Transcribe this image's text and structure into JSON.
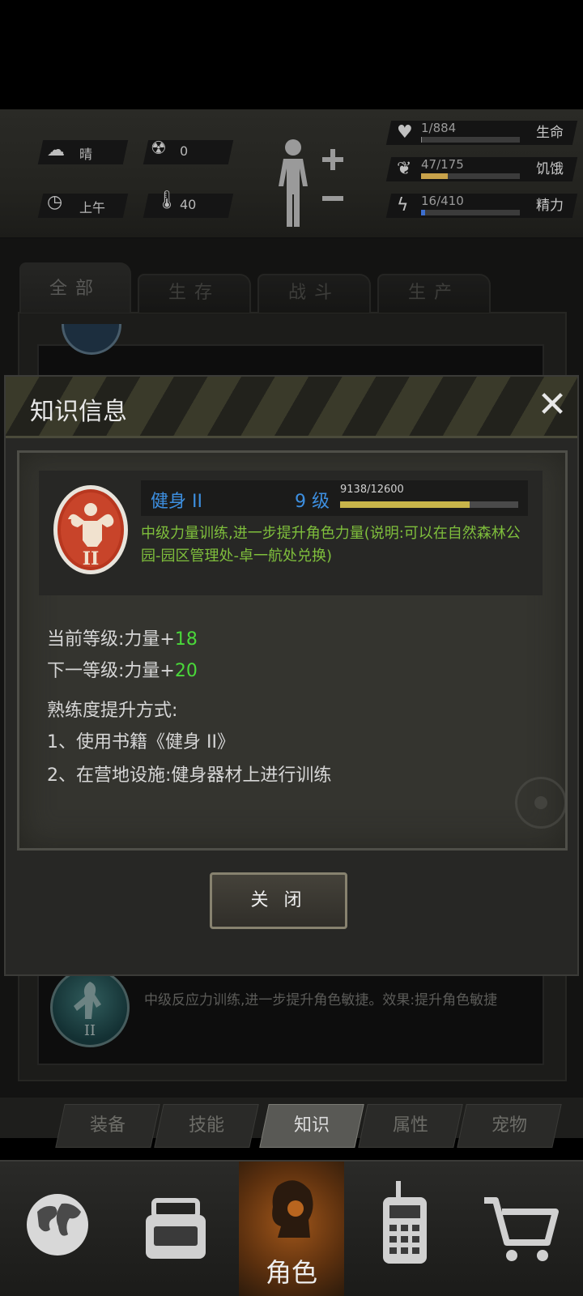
{
  "status": {
    "weather": "晴",
    "radiation": "0",
    "time_of_day": "上午",
    "temperature": "40",
    "stats": [
      {
        "icon": "heart-pulse-icon",
        "value": "1/884",
        "label": "生命",
        "fill": 0.0011,
        "color": "#8a8a8a"
      },
      {
        "icon": "stomach-icon",
        "value": "47/175",
        "label": "饥饿",
        "fill": 0.27,
        "color": "#c8a24a"
      },
      {
        "icon": "energy-head-icon",
        "value": "16/410",
        "label": "精力",
        "fill": 0.04,
        "color": "#3d6fcf"
      }
    ]
  },
  "category_tabs": [
    "全部",
    "生存",
    "战斗",
    "生产"
  ],
  "background_item": {
    "description": "中级反应力训练,进一步提升角色敏捷。效果:提升角色敏捷"
  },
  "dialog": {
    "title": "知识信息",
    "skill": {
      "name": "健身 II",
      "level": "9 级",
      "xp": "9138/12600",
      "xp_fraction": 0.725,
      "description": "中级力量训练,进一步提升角色力量(说明:可以在自然森林公园-园区管理处-卓一航处兑换)"
    },
    "current_level_label": "当前等级:力量+",
    "current_level_value": "18",
    "next_level_label": "下一等级:力量+",
    "next_level_value": "20",
    "method_title": "熟练度提升方式:",
    "method_1": "1、使用书籍《健身 II》",
    "method_2": "2、在营地设施:健身器材上进行训练",
    "close_label": "关 闭"
  },
  "sub_tabs": [
    "装备",
    "技能",
    "知识",
    "属性",
    "宠物"
  ],
  "bottom_nav": {
    "active_label": "角色",
    "items": [
      "globe-icon",
      "backpack-icon",
      "character-head-icon",
      "radio-phone-icon",
      "shopping-cart-icon"
    ]
  }
}
